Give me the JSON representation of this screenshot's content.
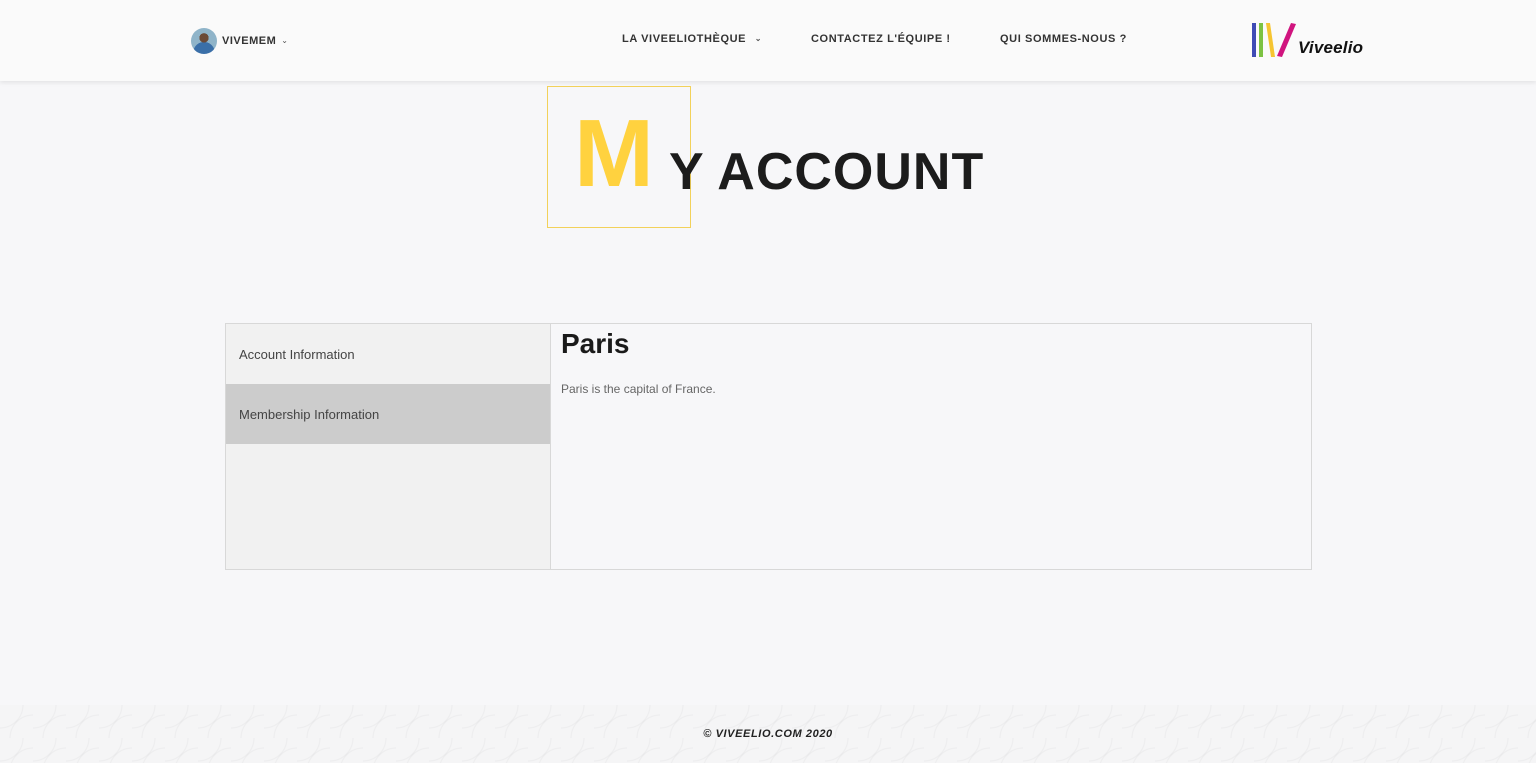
{
  "header": {
    "user": {
      "name": "VIVEMEM"
    },
    "nav": [
      {
        "label": "LA VIVEELIOTHÈQUE",
        "has_dropdown": true
      },
      {
        "label": "CONTACTEZ L'ÉQUIPE !",
        "has_dropdown": false
      },
      {
        "label": "QUI SOMMES-NOUS ?",
        "has_dropdown": false
      }
    ],
    "logo": {
      "text": "Viveelio"
    }
  },
  "title": {
    "first_letter": "M",
    "rest": "Y ACCOUNT"
  },
  "account": {
    "tabs": [
      {
        "label": "Account Information",
        "active": false
      },
      {
        "label": "Membership Information",
        "active": true
      }
    ],
    "content": {
      "heading": "Paris",
      "text": "Paris is the capital of France."
    }
  },
  "footer": {
    "copyright": "© VIVEELIO.COM 2020"
  },
  "colors": {
    "accent_yellow": "#ffd23f",
    "logo_blue": "#3f4bb5",
    "logo_green": "#7cc242",
    "logo_yellow": "#f6c531",
    "logo_magenta": "#d0147e"
  }
}
